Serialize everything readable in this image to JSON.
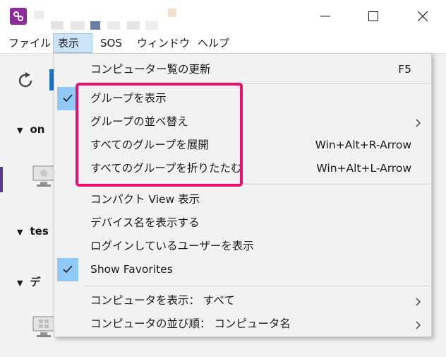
{
  "window": {
    "controls": [
      "minimize",
      "maximize",
      "close"
    ]
  },
  "menubar": {
    "items": [
      "ファイル",
      "表示",
      "SOS",
      "ウィンドウ",
      "ヘルプ"
    ],
    "active_index": 1
  },
  "background": {
    "groups": [
      "on",
      "tes",
      "デ"
    ]
  },
  "dropdown": {
    "items": [
      {
        "label": "コンピューター覧の更新",
        "shortcut": "F5",
        "checked": false,
        "submenu": false
      },
      {
        "label": "グループを表示",
        "shortcut": "",
        "checked": true,
        "submenu": false
      },
      {
        "label": "グループの並べ替え",
        "shortcut": "",
        "checked": false,
        "submenu": true
      },
      {
        "label": "すべてのグループを展開",
        "shortcut": "Win+Alt+R-Arrow",
        "checked": false,
        "submenu": false
      },
      {
        "label": "すべてのグループを折りたたむ",
        "shortcut": "Win+Alt+L-Arrow",
        "checked": false,
        "submenu": false
      },
      {
        "label": "コンパクト View 表示",
        "shortcut": "",
        "checked": false,
        "submenu": false
      },
      {
        "label": "デバイス名を表示する",
        "shortcut": "",
        "checked": false,
        "submenu": false
      },
      {
        "label": "ログインしているユーザーを表示",
        "shortcut": "",
        "checked": false,
        "submenu": false
      },
      {
        "label": "Show Favorites",
        "shortcut": "",
        "checked": true,
        "submenu": false
      },
      {
        "label": "コンピュータを表示： すべて",
        "shortcut": "",
        "checked": false,
        "submenu": true
      },
      {
        "label": "コンピュータの並び順： コンピュータ名",
        "shortcut": "",
        "checked": false,
        "submenu": true
      }
    ]
  },
  "colors": {
    "accent_purple": "#8e2b9a",
    "highlight_pink": "#e8106a",
    "check_blue": "#90c8f6",
    "menu_active": "#cce4f7"
  }
}
